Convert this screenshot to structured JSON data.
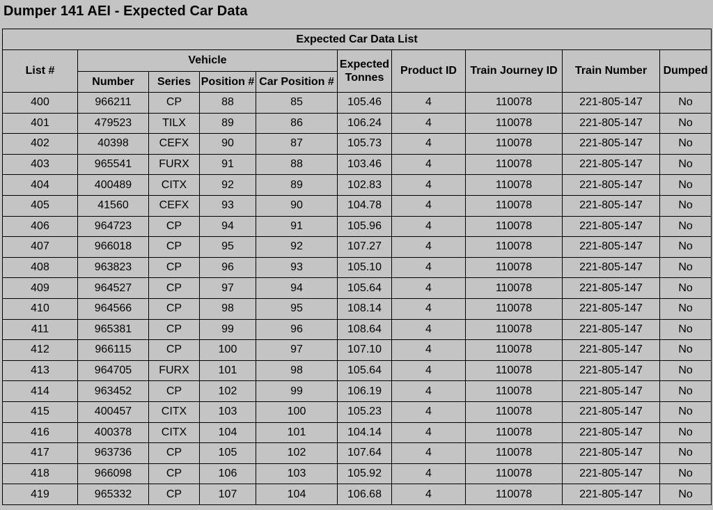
{
  "page": {
    "title": "Dumper 141 AEI - Expected Car Data"
  },
  "table": {
    "caption": "Expected Car Data List",
    "headers": {
      "list": "List #",
      "vehicle": "Vehicle",
      "number": "Number",
      "series": "Series",
      "position": "Position #",
      "car_position": "Car Position #",
      "expected_tonnes_line1": "Expected",
      "expected_tonnes_line2": "Tonnes",
      "product_id": "Product ID",
      "train_journey_id": "Train Journey ID",
      "train_number": "Train Number",
      "dumped": "Dumped"
    },
    "rows": [
      {
        "list": "400",
        "number": "966211",
        "series": "CP",
        "position": "88",
        "car_position": "85",
        "tonnes": "105.46",
        "product_id": "4",
        "journey_id": "110078",
        "train_number": "221-805-147",
        "dumped": "No"
      },
      {
        "list": "401",
        "number": "479523",
        "series": "TILX",
        "position": "89",
        "car_position": "86",
        "tonnes": "106.24",
        "product_id": "4",
        "journey_id": "110078",
        "train_number": "221-805-147",
        "dumped": "No"
      },
      {
        "list": "402",
        "number": "40398",
        "series": "CEFX",
        "position": "90",
        "car_position": "87",
        "tonnes": "105.73",
        "product_id": "4",
        "journey_id": "110078",
        "train_number": "221-805-147",
        "dumped": "No"
      },
      {
        "list": "403",
        "number": "965541",
        "series": "FURX",
        "position": "91",
        "car_position": "88",
        "tonnes": "103.46",
        "product_id": "4",
        "journey_id": "110078",
        "train_number": "221-805-147",
        "dumped": "No"
      },
      {
        "list": "404",
        "number": "400489",
        "series": "CITX",
        "position": "92",
        "car_position": "89",
        "tonnes": "102.83",
        "product_id": "4",
        "journey_id": "110078",
        "train_number": "221-805-147",
        "dumped": "No"
      },
      {
        "list": "405",
        "number": "41560",
        "series": "CEFX",
        "position": "93",
        "car_position": "90",
        "tonnes": "104.78",
        "product_id": "4",
        "journey_id": "110078",
        "train_number": "221-805-147",
        "dumped": "No"
      },
      {
        "list": "406",
        "number": "964723",
        "series": "CP",
        "position": "94",
        "car_position": "91",
        "tonnes": "105.96",
        "product_id": "4",
        "journey_id": "110078",
        "train_number": "221-805-147",
        "dumped": "No"
      },
      {
        "list": "407",
        "number": "966018",
        "series": "CP",
        "position": "95",
        "car_position": "92",
        "tonnes": "107.27",
        "product_id": "4",
        "journey_id": "110078",
        "train_number": "221-805-147",
        "dumped": "No"
      },
      {
        "list": "408",
        "number": "963823",
        "series": "CP",
        "position": "96",
        "car_position": "93",
        "tonnes": "105.10",
        "product_id": "4",
        "journey_id": "110078",
        "train_number": "221-805-147",
        "dumped": "No"
      },
      {
        "list": "409",
        "number": "964527",
        "series": "CP",
        "position": "97",
        "car_position": "94",
        "tonnes": "105.64",
        "product_id": "4",
        "journey_id": "110078",
        "train_number": "221-805-147",
        "dumped": "No"
      },
      {
        "list": "410",
        "number": "964566",
        "series": "CP",
        "position": "98",
        "car_position": "95",
        "tonnes": "108.14",
        "product_id": "4",
        "journey_id": "110078",
        "train_number": "221-805-147",
        "dumped": "No"
      },
      {
        "list": "411",
        "number": "965381",
        "series": "CP",
        "position": "99",
        "car_position": "96",
        "tonnes": "108.64",
        "product_id": "4",
        "journey_id": "110078",
        "train_number": "221-805-147",
        "dumped": "No"
      },
      {
        "list": "412",
        "number": "966115",
        "series": "CP",
        "position": "100",
        "car_position": "97",
        "tonnes": "107.10",
        "product_id": "4",
        "journey_id": "110078",
        "train_number": "221-805-147",
        "dumped": "No"
      },
      {
        "list": "413",
        "number": "964705",
        "series": "FURX",
        "position": "101",
        "car_position": "98",
        "tonnes": "105.64",
        "product_id": "4",
        "journey_id": "110078",
        "train_number": "221-805-147",
        "dumped": "No"
      },
      {
        "list": "414",
        "number": "963452",
        "series": "CP",
        "position": "102",
        "car_position": "99",
        "tonnes": "106.19",
        "product_id": "4",
        "journey_id": "110078",
        "train_number": "221-805-147",
        "dumped": "No"
      },
      {
        "list": "415",
        "number": "400457",
        "series": "CITX",
        "position": "103",
        "car_position": "100",
        "tonnes": "105.23",
        "product_id": "4",
        "journey_id": "110078",
        "train_number": "221-805-147",
        "dumped": "No"
      },
      {
        "list": "416",
        "number": "400378",
        "series": "CITX",
        "position": "104",
        "car_position": "101",
        "tonnes": "104.14",
        "product_id": "4",
        "journey_id": "110078",
        "train_number": "221-805-147",
        "dumped": "No"
      },
      {
        "list": "417",
        "number": "963736",
        "series": "CP",
        "position": "105",
        "car_position": "102",
        "tonnes": "107.64",
        "product_id": "4",
        "journey_id": "110078",
        "train_number": "221-805-147",
        "dumped": "No"
      },
      {
        "list": "418",
        "number": "966098",
        "series": "CP",
        "position": "106",
        "car_position": "103",
        "tonnes": "105.92",
        "product_id": "4",
        "journey_id": "110078",
        "train_number": "221-805-147",
        "dumped": "No"
      },
      {
        "list": "419",
        "number": "965332",
        "series": "CP",
        "position": "107",
        "car_position": "104",
        "tonnes": "106.68",
        "product_id": "4",
        "journey_id": "110078",
        "train_number": "221-805-147",
        "dumped": "No"
      }
    ]
  },
  "colors": {
    "background": "#c4c4c4",
    "text": "#000000",
    "border": "#000000"
  }
}
